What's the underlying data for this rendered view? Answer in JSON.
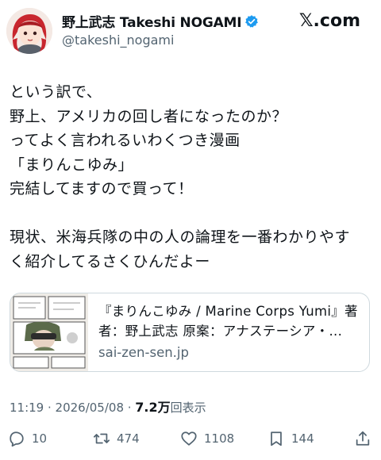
{
  "author": {
    "display_name": "野上武志 Takeshi NOGAMI",
    "handle": "@takeshi_nogami",
    "verified_icon": "verified-badge-icon",
    "badge_color": "#1d9bf0"
  },
  "site_logo": "𝕏.com",
  "tweet": {
    "lines": [
      "という訳で、",
      "野上、アメリカの回し者になったのか？",
      "ってよく言われるいわくつき漫画",
      "「まりんこゆみ」",
      "完結してますので買って！",
      "",
      "現状、米海兵隊の中の人の論理を一番わかりやす",
      "く紹介してるさくひんだよー"
    ]
  },
  "link_card": {
    "title_line1": "『まりんこゆみ / Marine Corps Yumi』著",
    "title_line2": "者：野上武志 原案：アナステーシア・...",
    "domain": "sai-zen-sen.jp"
  },
  "meta": {
    "time": "11:19 · 2026/05/08 · ",
    "views": "7.2万",
    "views_label": "回表示"
  },
  "actions": {
    "replies": "10",
    "retweets": "474",
    "likes": "1108",
    "bookmarks": "144"
  },
  "colors": {
    "text": "#0f1419",
    "muted": "#536471",
    "border": "#cfd9de"
  }
}
